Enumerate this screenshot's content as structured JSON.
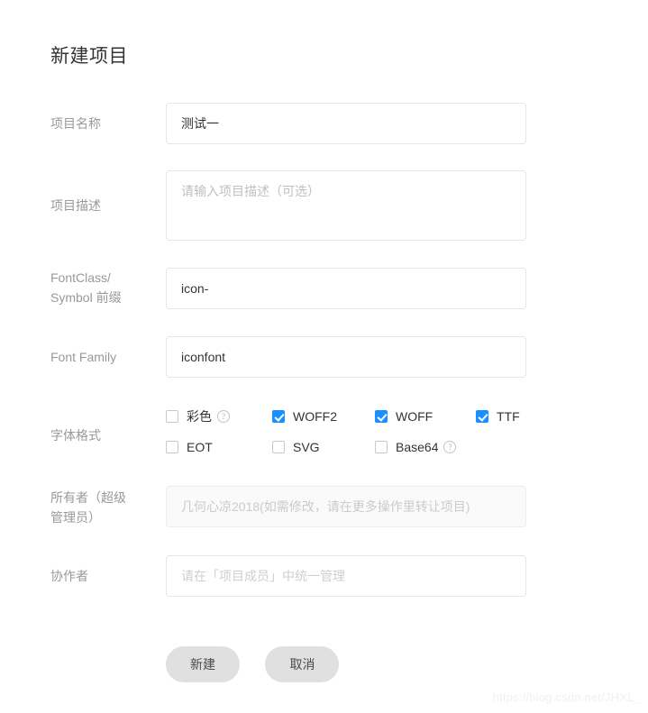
{
  "page": {
    "title": "新建项目",
    "watermark": "https://blog.csdn.net/JHXL_"
  },
  "fields": {
    "project_name": {
      "label": "项目名称",
      "value": "测试一",
      "placeholder": ""
    },
    "project_desc": {
      "label": "项目描述",
      "value": "",
      "placeholder": "请输入项目描述（可选）"
    },
    "prefix": {
      "label": "FontClass/\nSymbol 前缀",
      "label_line1": "FontClass/",
      "label_line2": "Symbol 前缀",
      "value": "icon-",
      "placeholder": ""
    },
    "font_family": {
      "label": "Font Family",
      "value": "iconfont",
      "placeholder": ""
    },
    "font_format": {
      "label": "字体格式",
      "options": [
        {
          "label": "彩色",
          "checked": false,
          "help": true
        },
        {
          "label": "WOFF2",
          "checked": true,
          "help": false
        },
        {
          "label": "WOFF",
          "checked": true,
          "help": false
        },
        {
          "label": "TTF",
          "checked": true,
          "help": false
        },
        {
          "label": "EOT",
          "checked": false,
          "help": false
        },
        {
          "label": "SVG",
          "checked": false,
          "help": false
        },
        {
          "label": "Base64",
          "checked": false,
          "help": true
        }
      ]
    },
    "owner": {
      "label_line1": "所有者（超级",
      "label_line2": "管理员）",
      "value": "",
      "placeholder": "几何心凉2018(如需修改，请在更多操作里转让项目)",
      "disabled": true
    },
    "collaborator": {
      "label": "协作者",
      "value": "",
      "placeholder": "请在「项目成员」中统一管理"
    }
  },
  "buttons": {
    "submit": "新建",
    "cancel": "取消"
  },
  "colors": {
    "accent": "#1890ff",
    "label": "#999999",
    "border": "#e4e6eb",
    "button_bg": "#e0e0e0"
  },
  "icons": {
    "help": "?"
  }
}
